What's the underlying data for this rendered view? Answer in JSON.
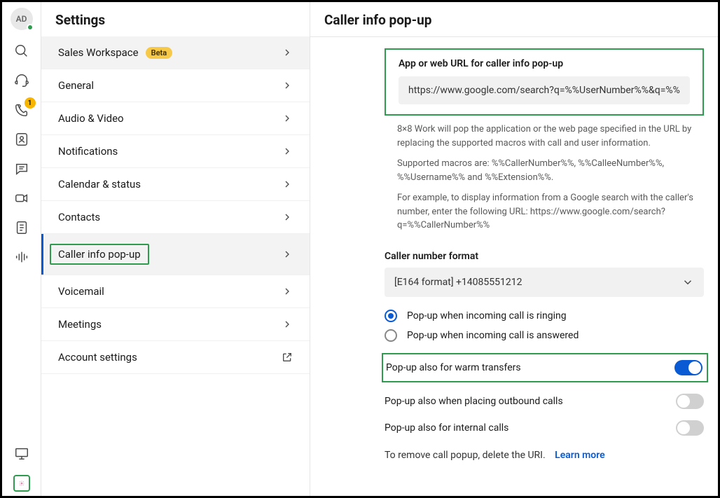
{
  "iconrail": {
    "avatar_initials": "AD",
    "phone_badge": "1"
  },
  "settings": {
    "title": "Settings",
    "items": [
      {
        "label": "Sales Workspace",
        "beta": "Beta"
      },
      {
        "label": "General"
      },
      {
        "label": "Audio & Video"
      },
      {
        "label": "Notifications"
      },
      {
        "label": "Calendar & status"
      },
      {
        "label": "Contacts"
      },
      {
        "label": "Caller info pop-up"
      },
      {
        "label": "Voicemail"
      },
      {
        "label": "Meetings"
      },
      {
        "label": "Account settings"
      }
    ]
  },
  "main": {
    "title": "Caller info pop-up",
    "url_section": {
      "label": "App or web URL for caller info pop-up",
      "value": "https://www.google.com/search?q=%%UserNumber%%&q=%%E"
    },
    "help": {
      "p1": "8×8 Work will pop the application or the web page specified in the URL by replacing the supported macros with call and user information.",
      "p2": "Supported macros are: %%CallerNumber%%, %%CalleeNumber%%, %%Username%% and %%Extension%%.",
      "p3": "For example, to display information from a Google search with the caller's number, enter the following URL: https://www.google.com/search?q=%%CallerNumber%%"
    },
    "format": {
      "label": "Caller number format",
      "selected": "[E164 format] +14085551212"
    },
    "radios": {
      "opt1": "Pop-up when incoming call is ringing",
      "opt2": "Pop-up when incoming call is answered"
    },
    "toggles": {
      "warm": "Pop-up also for warm transfers",
      "outbound": "Pop-up also when placing outbound calls",
      "internal": "Pop-up also for internal calls"
    },
    "remove_note": "To remove call popup, delete the URI.",
    "learn_more": "Learn more"
  }
}
